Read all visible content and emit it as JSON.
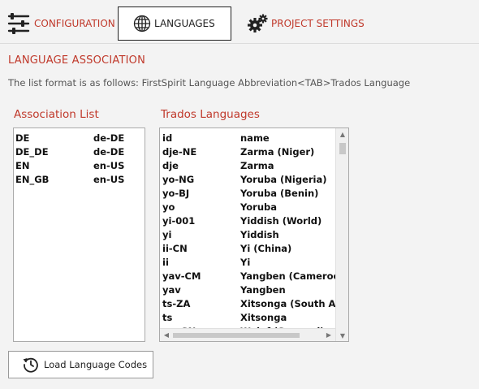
{
  "tabs": [
    {
      "label": "CONFIGURATION",
      "icon": "sliders-icon"
    },
    {
      "label": "LANGUAGES",
      "icon": "globe-icon",
      "active": true
    },
    {
      "label": "PROJECT SETTINGS",
      "icon": "gears-icon"
    }
  ],
  "section": {
    "title": "LANGUAGE ASSOCIATION",
    "format_text": "The list format is as follows:  FirstSpirit Language Abbreviation<TAB>Trados Language"
  },
  "association_list": {
    "label": "Association List",
    "rows": [
      [
        "DE",
        "de-DE"
      ],
      [
        "DE_DE",
        "de-DE"
      ],
      [
        "EN",
        "en-US"
      ],
      [
        "EN_GB",
        "en-US"
      ]
    ]
  },
  "trados_languages": {
    "label": "Trados Languages",
    "rows": [
      [
        "id",
        "name"
      ],
      [
        "dje-NE",
        "Zarma (Niger)"
      ],
      [
        "dje",
        "Zarma"
      ],
      [
        "yo-NG",
        "Yoruba (Nigeria)"
      ],
      [
        "yo-BJ",
        "Yoruba (Benin)"
      ],
      [
        "yo",
        "Yoruba"
      ],
      [
        "yi-001",
        "Yiddish (World)"
      ],
      [
        "yi",
        "Yiddish"
      ],
      [
        "ii-CN",
        "Yi (China)"
      ],
      [
        "ii",
        "Yi"
      ],
      [
        "yav-CM",
        "Yangben (Cameroon)"
      ],
      [
        "yav",
        "Yangben"
      ],
      [
        "ts-ZA",
        "Xitsonga (South Africa)"
      ],
      [
        "ts",
        "Xitsonga"
      ],
      [
        "wo-SN",
        "Wolof (Senegal)"
      ]
    ]
  },
  "load_button": {
    "label": "Load Language Codes",
    "icon": "history-icon"
  },
  "colors": {
    "accent": "#c0392b",
    "background": "#f3f3f3"
  }
}
